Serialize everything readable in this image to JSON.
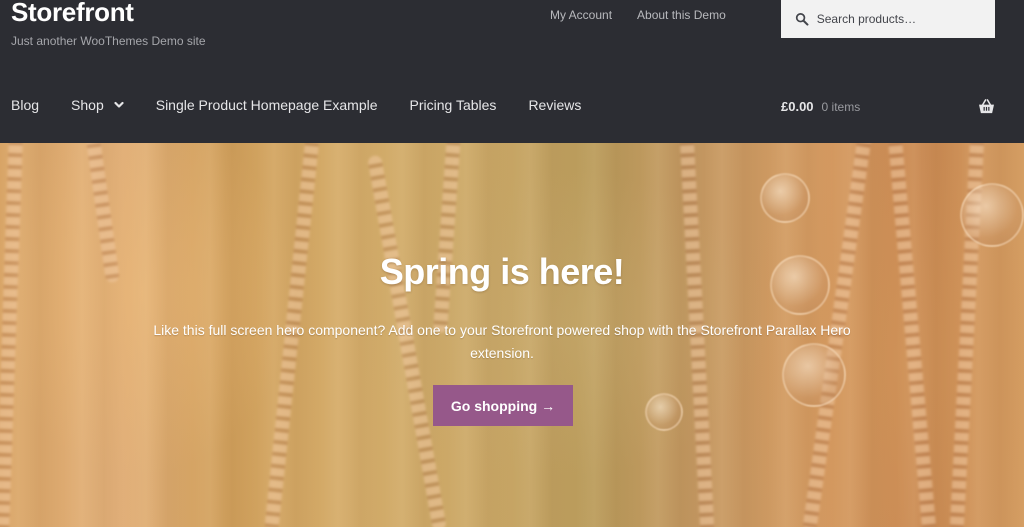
{
  "site": {
    "title": "Storefront",
    "tagline": "Just another WooThemes Demo site"
  },
  "secondary_nav": {
    "items": [
      {
        "label": "My Account"
      },
      {
        "label": "About this Demo"
      }
    ]
  },
  "search": {
    "placeholder": "Search products…",
    "icon": "search-icon"
  },
  "primary_nav": {
    "items": [
      {
        "label": "Blog"
      },
      {
        "label": "Shop",
        "icon": "chevron-down-icon"
      },
      {
        "label": "Single Product Homepage Example"
      },
      {
        "label": "Pricing Tables"
      },
      {
        "label": "Reviews"
      }
    ]
  },
  "cart": {
    "amount": "£0.00",
    "count": "0 items",
    "icon": "basket-icon"
  },
  "hero": {
    "title": "Spring is here!",
    "text": "Like this full screen hero component? Add one to your Storefront powered shop with the Storefront Parallax Hero extension.",
    "button_label": "Go shopping →"
  },
  "colors": {
    "header_bg": "#2c2d33",
    "accent": "#96588a",
    "search_bg": "#f2f2f2"
  }
}
